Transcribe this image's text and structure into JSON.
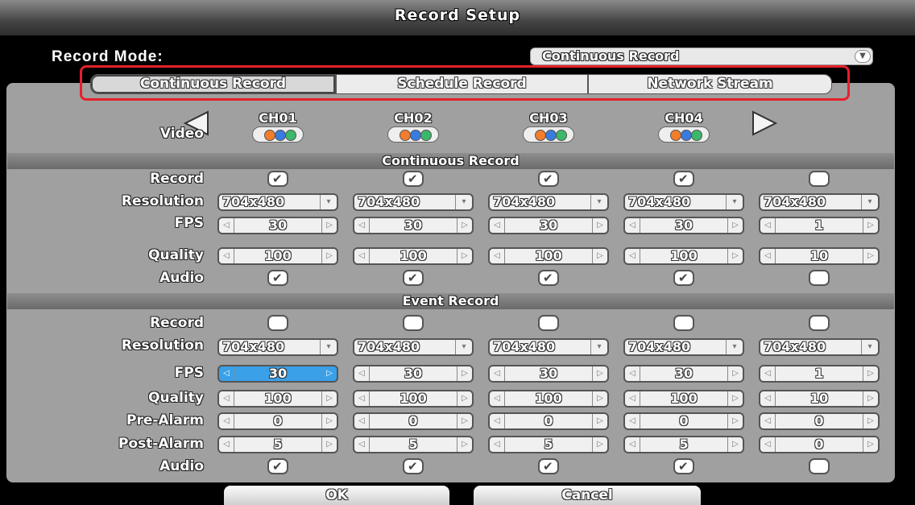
{
  "title": "Record Setup",
  "record_mode": {
    "label": "Record Mode:",
    "value": "Continuous Record"
  },
  "tabs": [
    "Continuous Record",
    "Schedule Record",
    "Network Stream"
  ],
  "video_label": "Video",
  "channels": [
    "CH01",
    "CH02",
    "CH03",
    "CH04"
  ],
  "sections": {
    "continuous": "Continuous Record",
    "event": "Event Record"
  },
  "row_labels": {
    "record": "Record",
    "resolution": "Resolution",
    "fps": "FPS",
    "quality": "Quality",
    "pre_alarm": "Pre-Alarm",
    "post_alarm": "Post-Alarm",
    "audio": "Audio"
  },
  "continuous": {
    "record": [
      true,
      true,
      true,
      true,
      false
    ],
    "resolution": [
      "704x480",
      "704x480",
      "704x480",
      "704x480",
      "704x480"
    ],
    "fps": [
      "30",
      "30",
      "30",
      "30",
      "1"
    ],
    "quality": [
      "100",
      "100",
      "100",
      "100",
      "10"
    ],
    "audio": [
      true,
      true,
      true,
      true,
      false
    ]
  },
  "event": {
    "record": [
      false,
      false,
      false,
      false,
      false
    ],
    "resolution": [
      "704x480",
      "704x480",
      "704x480",
      "704x480",
      "704x480"
    ],
    "fps": [
      "30",
      "30",
      "30",
      "30",
      "1"
    ],
    "quality": [
      "100",
      "100",
      "100",
      "100",
      "10"
    ],
    "pre_alarm": [
      "0",
      "0",
      "0",
      "0",
      "0"
    ],
    "post_alarm": [
      "5",
      "5",
      "5",
      "5",
      "0"
    ],
    "audio": [
      true,
      true,
      true,
      true,
      false
    ]
  },
  "buttons": {
    "ok": "OK",
    "cancel": "Cancel"
  },
  "colors": {
    "highlight": "#e5202a",
    "active_field": "#3aa0e8"
  }
}
